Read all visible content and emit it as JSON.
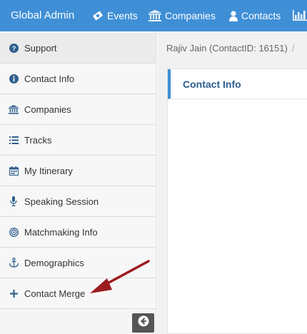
{
  "topbar": {
    "brand": "Global Admin",
    "nav": [
      {
        "label": "Events",
        "icon": "ticket-icon"
      },
      {
        "label": "Companies",
        "icon": "bank-icon"
      },
      {
        "label": "Contacts",
        "icon": "user-icon"
      },
      {
        "label": "",
        "icon": "bar-chart-icon"
      }
    ]
  },
  "sidebar": {
    "items": [
      {
        "label": "Support",
        "icon": "question-circle-icon"
      },
      {
        "label": "Contact Info",
        "icon": "info-circle-icon"
      },
      {
        "label": "Companies",
        "icon": "bank-icon"
      },
      {
        "label": "Tracks",
        "icon": "list-icon"
      },
      {
        "label": "My Itinerary",
        "icon": "calendar-icon"
      },
      {
        "label": "Speaking Session",
        "icon": "microphone-icon"
      },
      {
        "label": "Matchmaking Info",
        "icon": "bullseye-icon"
      },
      {
        "label": "Demographics",
        "icon": "anchor-icon"
      },
      {
        "label": "Contact Merge",
        "icon": "plus-icon"
      }
    ]
  },
  "main": {
    "breadcrumb": "Rajiv Jain (ContactID: 16151)",
    "breadcrumb_sep": "/",
    "panel_title": "Contact Info"
  },
  "colors": {
    "brand_blue": "#3f8fd6",
    "panel_title": "#2c5d8f",
    "annotation_arrow": "#9b1c1f"
  }
}
